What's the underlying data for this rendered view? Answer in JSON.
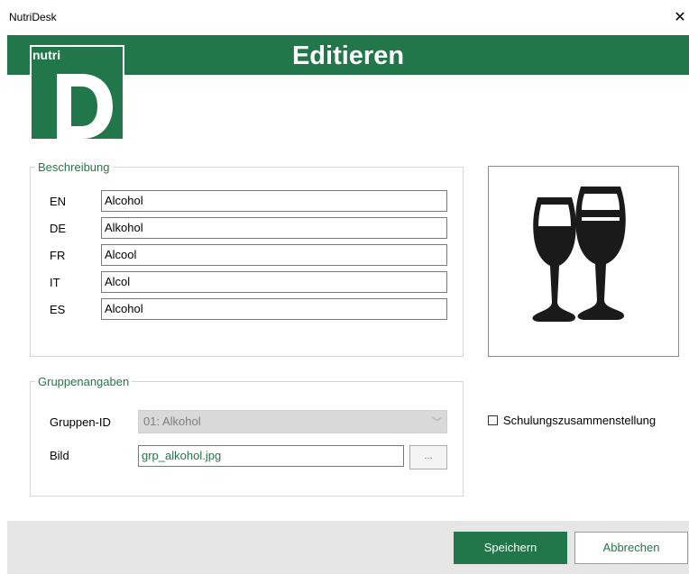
{
  "window": {
    "title": "NutriDesk",
    "close_glyph": "✕"
  },
  "header": {
    "title": "Editieren"
  },
  "logo": {
    "text": "nutri",
    "letter": "D"
  },
  "description": {
    "legend": "Beschreibung",
    "rows": [
      {
        "lang": "EN",
        "value": "Alcohol"
      },
      {
        "lang": "DE",
        "value": "Alkohol"
      },
      {
        "lang": "FR",
        "value": "Alcool"
      },
      {
        "lang": "IT",
        "value": "Alcol"
      },
      {
        "lang": "ES",
        "value": "Alcohol"
      }
    ]
  },
  "picture": {
    "icon": "wine-glasses-icon"
  },
  "group": {
    "legend": "Gruppenangaben",
    "id_label": "Gruppen-ID",
    "id_value": "01: Alkohol",
    "image_label": "Bild",
    "image_value": "grp_alkohol.jpg",
    "browse_label": "..."
  },
  "training": {
    "label": "Schulungszusammenstellung",
    "checked": false
  },
  "footer": {
    "save_label": "Speichern",
    "cancel_label": "Abbrechen"
  },
  "colors": {
    "brand": "#22774a",
    "footer_bg": "#e6e6e6"
  }
}
